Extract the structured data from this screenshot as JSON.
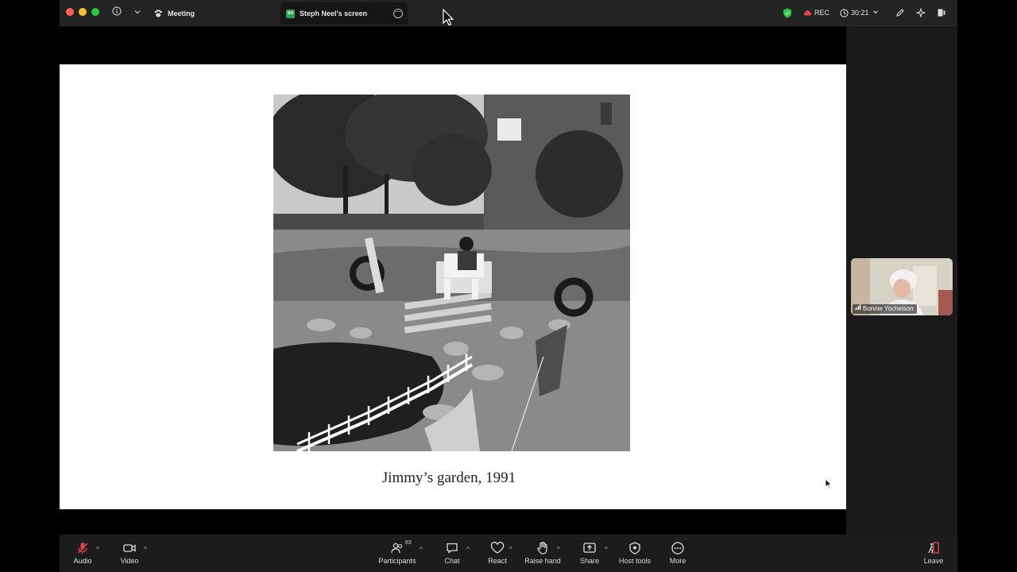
{
  "titlebar": {
    "meeting_tab": "Meeting",
    "screen_tab": "Steph Neel's screen",
    "screen_badge": "SN",
    "rec_label": "REC",
    "timer": "30:21"
  },
  "slide": {
    "caption": "Jimmy’s garden, 1991"
  },
  "participant": {
    "name": "Bonnie Yochelson"
  },
  "toolbar": {
    "audio": "Audio",
    "video": "Video",
    "participants": "Participants",
    "participants_count": "63",
    "chat": "Chat",
    "react": "React",
    "raise_hand": "Raise hand",
    "share": "Share",
    "host_tools": "Host tools",
    "more": "More",
    "leave": "Leave"
  },
  "colors": {
    "traffic_red": "#ff5f57",
    "traffic_yellow": "#febc2e",
    "traffic_green": "#28c840",
    "mute_red": "#e0434a",
    "shield_green": "#28c840"
  }
}
